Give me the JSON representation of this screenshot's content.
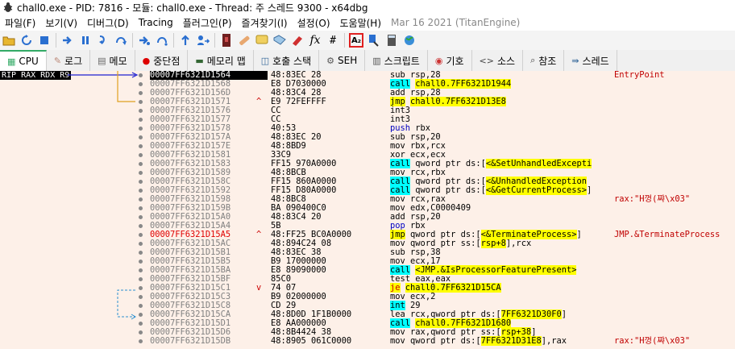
{
  "window": {
    "title": "chall0.exe - PID: 7816 - 모듈: chall0.exe - Thread: 주 스레드 9300 - x64dbg"
  },
  "menu": [
    "파일(F)",
    "보기(V)",
    "디버그(D)",
    "Tracing",
    "플러그인(P)",
    "즐겨찾기(I)",
    "설정(O)",
    "도움말(H)",
    "Mar 16 2021 (TitanEngine)"
  ],
  "toolbar": {
    "selected_icon": "A₂"
  },
  "tabs": [
    {
      "label": "CPU",
      "icon": "cpu-icon"
    },
    {
      "label": "로그",
      "icon": "log-icon"
    },
    {
      "label": "메모",
      "icon": "notes-icon"
    },
    {
      "label": "중단점",
      "icon": "breakpoint-icon"
    },
    {
      "label": "메모리 맵",
      "icon": "memory-map-icon"
    },
    {
      "label": "호출 스택",
      "icon": "call-stack-icon"
    },
    {
      "label": "SEH",
      "icon": "seh-icon"
    },
    {
      "label": "스크립트",
      "icon": "script-icon"
    },
    {
      "label": "기호",
      "icon": "symbols-icon"
    },
    {
      "label": "소스",
      "icon": "source-icon"
    },
    {
      "label": "참조",
      "icon": "references-icon"
    },
    {
      "label": "스레드",
      "icon": "threads-icon"
    }
  ],
  "registers_label": "RIP RAX RDX R9",
  "rows": [
    {
      "addr": "00007FF6321D1564",
      "bytes": "48:83EC 28",
      "mn": "sub",
      "ops": "rsp,28",
      "comment": "EntryPoint",
      "style": "current"
    },
    {
      "addr": "00007FF6321D1568",
      "bytes": "E8 D7030000",
      "mn": "call",
      "ops": "chall0.7FF6321D1944",
      "style": "call"
    },
    {
      "addr": "00007FF6321D156D",
      "bytes": "48:83C4 28",
      "mn": "add",
      "ops": "rsp,28"
    },
    {
      "addr": "00007FF6321D1571",
      "bytes": "E9 72FEFFFF",
      "mn": "jmp",
      "ops": "chall0.7FF6321D13E8",
      "style": "jmp",
      "mark": "^"
    },
    {
      "addr": "00007FF6321D1576",
      "bytes": "CC",
      "mn": "int3",
      "ops": ""
    },
    {
      "addr": "00007FF6321D1577",
      "bytes": "CC",
      "mn": "int3",
      "ops": ""
    },
    {
      "addr": "00007FF6321D1578",
      "bytes": "40:53",
      "mn": "push",
      "ops": "rbx",
      "style": "push"
    },
    {
      "addr": "00007FF6321D157A",
      "bytes": "48:83EC 20",
      "mn": "sub",
      "ops": "rsp,20"
    },
    {
      "addr": "00007FF6321D157E",
      "bytes": "48:8BD9",
      "mn": "mov",
      "ops": "rbx,rcx"
    },
    {
      "addr": "00007FF6321D1581",
      "bytes": "33C9",
      "mn": "xor",
      "ops": "ecx,ecx"
    },
    {
      "addr": "00007FF6321D1583",
      "bytes": "FF15 970A0000",
      "mn": "call",
      "ops": "qword ptr ds:[<&SetUnhandledExcepti",
      "style": "callptr"
    },
    {
      "addr": "00007FF6321D1589",
      "bytes": "48:8BCB",
      "mn": "mov",
      "ops": "rcx,rbx"
    },
    {
      "addr": "00007FF6321D158C",
      "bytes": "FF15 860A0000",
      "mn": "call",
      "ops": "qword ptr ds:[<&UnhandledException",
      "style": "callptr"
    },
    {
      "addr": "00007FF6321D1592",
      "bytes": "FF15 D80A0000",
      "mn": "call",
      "ops": "qword ptr ds:[<&GetCurrentProcess>]",
      "style": "callptr"
    },
    {
      "addr": "00007FF6321D1598",
      "bytes": "48:8BC8",
      "mn": "mov",
      "ops": "rcx,rax",
      "comment": "rax:\"H껑(쨔\\x03\""
    },
    {
      "addr": "00007FF6321D159B",
      "bytes": "BA 090400C0",
      "mn": "mov",
      "ops": "edx,C0000409"
    },
    {
      "addr": "00007FF6321D15A0",
      "bytes": "48:83C4 20",
      "mn": "add",
      "ops": "rsp,20"
    },
    {
      "addr": "00007FF6321D15A4",
      "bytes": "5B",
      "mn": "pop",
      "ops": "rbx",
      "style": "push"
    },
    {
      "addr": "00007FF6321D15A5",
      "bytes": "48:FF25 BC0A0000",
      "mn": "jmp",
      "ops": "qword ptr ds:[<&TerminateProcess>]",
      "comment": "JMP.&TerminateProcess",
      "style": "jmpptr",
      "mark": "^",
      "addrstyle": "red"
    },
    {
      "addr": "00007FF6321D15AC",
      "bytes": "48:894C24 08",
      "mn": "mov",
      "ops": "qword ptr ss:[rsp+8],rcx",
      "style": "ss"
    },
    {
      "addr": "00007FF6321D15B1",
      "bytes": "48:83EC 38",
      "mn": "sub",
      "ops": "rsp,38"
    },
    {
      "addr": "00007FF6321D15B5",
      "bytes": "B9 17000000",
      "mn": "mov",
      "ops": "ecx,17"
    },
    {
      "addr": "00007FF6321D15BA",
      "bytes": "E8 89090000",
      "mn": "call",
      "ops": "<JMP.&IsProcessorFeaturePresent>",
      "style": "calljmp"
    },
    {
      "addr": "00007FF6321D15BF",
      "bytes": "85C0",
      "mn": "test",
      "ops": "eax,eax"
    },
    {
      "addr": "00007FF6321D15C1",
      "bytes": "74 07",
      "mn": "je",
      "ops": "chall0.7FF6321D15CA",
      "style": "je",
      "mark": "v"
    },
    {
      "addr": "00007FF6321D15C3",
      "bytes": "B9 02000000",
      "mn": "mov",
      "ops": "ecx,2"
    },
    {
      "addr": "00007FF6321D15C8",
      "bytes": "CD 29",
      "mn": "int",
      "ops": "29",
      "style": "int"
    },
    {
      "addr": "00007FF6321D15CA",
      "bytes": "48:8D0D 1F1B0000",
      "mn": "lea",
      "ops": "rcx,qword ptr ds:[7FF6321D30F0]",
      "style": "lea"
    },
    {
      "addr": "00007FF6321D15D1",
      "bytes": "E8 AA000000",
      "mn": "call",
      "ops": "chall0.7FF6321D1680",
      "style": "call"
    },
    {
      "addr": "00007FF6321D15D6",
      "bytes": "48:8B4424 38",
      "mn": "mov",
      "ops": "rax,qword ptr ss:[rsp+38]",
      "style": "ss"
    },
    {
      "addr": "00007FF6321D15DB",
      "bytes": "48:8905 061C0000",
      "mn": "mov",
      "ops": "qword ptr ds:[7FF6321D31E8],rax",
      "comment": "rax:\"H껑(쨔\\x03\"",
      "style": "dsmov"
    }
  ]
}
